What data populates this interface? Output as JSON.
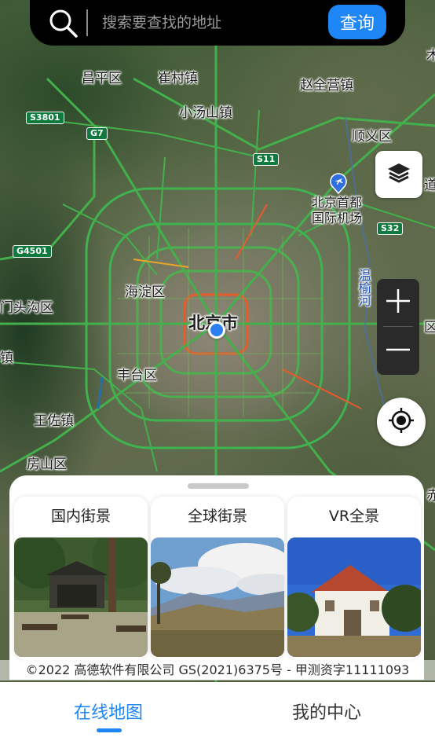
{
  "search": {
    "placeholder": "搜索要查找的地址",
    "button_label": "查询"
  },
  "map": {
    "labels": {
      "changping": "昌平区",
      "cuicun": "崔村镇",
      "zhaoquanying": "赵全营镇",
      "xiaotangshan": "小汤山镇",
      "shunyi": "顺义区",
      "airport_line1": "北京首都",
      "airport_line2": "国际机场",
      "haidian": "海淀区",
      "beijing": "北京市",
      "mentougou": "门头沟区",
      "fengtai": "丰台区",
      "wangzuo": "王佐镇",
      "fangshan": "房山区",
      "wenyu_river": "温榆河",
      "edge_mu": "木",
      "edge_zhen": "镇",
      "edge_dao": "道",
      "edge_qu": "区",
      "edge_chi": "赤"
    },
    "shields": {
      "s3801": "S3801",
      "g7": "G7",
      "s11": "S11",
      "s32": "S32",
      "g4501": "G4501"
    }
  },
  "controls": {
    "layers_icon": "layers-icon",
    "zoom_in_icon": "plus-icon",
    "zoom_out_icon": "minus-icon",
    "locate_icon": "crosshair-icon"
  },
  "sheet": {
    "cards": [
      {
        "title": "国内街景"
      },
      {
        "title": "全球街景"
      },
      {
        "title": "VR全景"
      }
    ]
  },
  "copyright": "©2022 高德软件有限公司 GS(2021)6375号 - 甲测资字11111093",
  "tabs": {
    "map": "在线地图",
    "me": "我的中心"
  },
  "colors": {
    "accent": "#1e86f5",
    "search_bar": "#000000"
  }
}
